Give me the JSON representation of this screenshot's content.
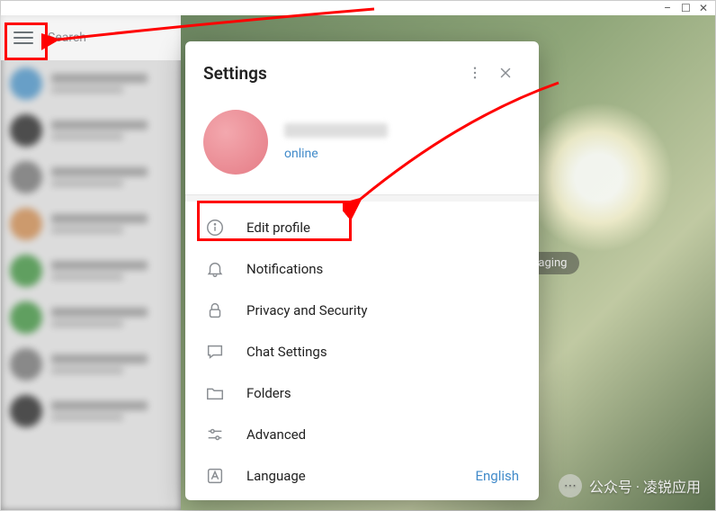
{
  "header": {
    "search_placeholder": "Search"
  },
  "background": {
    "pill_text": "ssaging"
  },
  "settings": {
    "title": "Settings",
    "status": "online",
    "items": [
      {
        "id": "edit-profile",
        "label": "Edit profile",
        "icon": "info"
      },
      {
        "id": "notifications",
        "label": "Notifications",
        "icon": "bell"
      },
      {
        "id": "privacy",
        "label": "Privacy and Security",
        "icon": "lock"
      },
      {
        "id": "chat",
        "label": "Chat Settings",
        "icon": "chat"
      },
      {
        "id": "folders",
        "label": "Folders",
        "icon": "folder"
      },
      {
        "id": "advanced",
        "label": "Advanced",
        "icon": "sliders"
      },
      {
        "id": "language",
        "label": "Language",
        "icon": "language",
        "value": "English"
      }
    ]
  },
  "watermark": {
    "text": "公众号 · 凌锐应用"
  }
}
